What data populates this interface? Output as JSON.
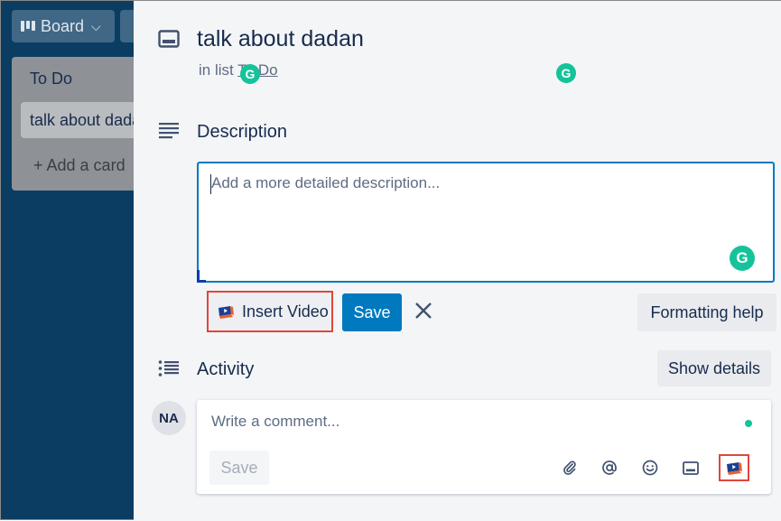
{
  "board": {
    "view_button": "Board",
    "list_title": "To Do",
    "card_text": "talk about dadan",
    "add_card": "+ Add a card"
  },
  "card": {
    "title": "talk about dadan",
    "in_list_prefix": "in list ",
    "list_name": "To Do"
  },
  "description": {
    "heading": "Description",
    "placeholder": "Add a more detailed description...",
    "insert_video": "Insert Video",
    "save": "Save",
    "formatting_help": "Formatting help"
  },
  "activity": {
    "heading": "Activity",
    "show_details": "Show details",
    "avatar_initials": "NA",
    "comment_placeholder": "Write a comment...",
    "save": "Save"
  },
  "colors": {
    "primary": "#0079bf",
    "grammarly": "#15c39a",
    "highlight": "#e2453c"
  },
  "icons": [
    "card-icon",
    "description-icon",
    "activity-icon",
    "attachment-icon",
    "mention-icon",
    "emoji-icon",
    "card-embed-icon",
    "video-icon",
    "close-icon",
    "grammarly-icon"
  ]
}
